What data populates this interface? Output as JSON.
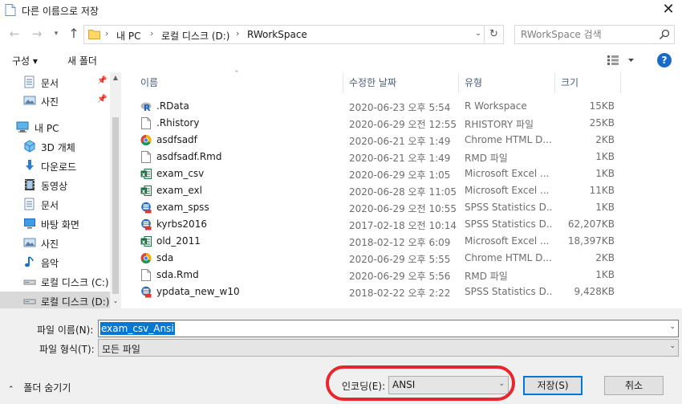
{
  "window": {
    "title": "다른 이름으로 저장",
    "close_glyph": "✕"
  },
  "address": {
    "crumbs": [
      "내 PC",
      "로컬 디스크 (D:)",
      "RWorkSpace"
    ],
    "search_placeholder": "RWorkSpace 검색"
  },
  "toolbar": {
    "organize": "구성 ▾",
    "new_folder": "새 폴더",
    "help": "?"
  },
  "nav": {
    "items": [
      {
        "label": "문서",
        "icon": "documents-icon",
        "pinned": true
      },
      {
        "label": "사진",
        "icon": "pictures-icon",
        "pinned": true
      },
      {
        "label": "내 PC",
        "icon": "this-pc-icon"
      },
      {
        "label": "3D 개체",
        "icon": "3d-objects-icon"
      },
      {
        "label": "다운로드",
        "icon": "downloads-icon"
      },
      {
        "label": "동영상",
        "icon": "videos-icon"
      },
      {
        "label": "문서",
        "icon": "documents-icon"
      },
      {
        "label": "바탕 화면",
        "icon": "desktop-icon"
      },
      {
        "label": "사진",
        "icon": "pictures-icon"
      },
      {
        "label": "음악",
        "icon": "music-icon"
      },
      {
        "label": "로컬 디스크 (C:)",
        "icon": "drive-icon"
      },
      {
        "label": "로컬 디스크 (D:)",
        "icon": "drive-icon",
        "selected": true
      }
    ]
  },
  "columns": {
    "name": "이름",
    "modified": "수정한 날짜",
    "type": "유형",
    "size": "크기"
  },
  "files": [
    {
      "name": ".RData",
      "date": "2020-06-23 오후 5:54",
      "type": "R Workspace",
      "size": "15KB",
      "icon": "r-icon"
    },
    {
      "name": ".Rhistory",
      "date": "2020-06-29 오전 12:55",
      "type": "RHISTORY 파일",
      "size": "25KB",
      "icon": "file-icon"
    },
    {
      "name": "asdfsadf",
      "date": "2020-06-21 오후 1:49",
      "type": "Chrome HTML D...",
      "size": "2KB",
      "icon": "chrome-icon"
    },
    {
      "name": "asdfsadf.Rmd",
      "date": "2020-06-21 오후 1:49",
      "type": "RMD 파일",
      "size": "1KB",
      "icon": "file-icon"
    },
    {
      "name": "exam_csv",
      "date": "2020-06-29 오후 1:05",
      "type": "Microsoft Excel ...",
      "size": "1KB",
      "icon": "excel-icon"
    },
    {
      "name": "exam_exl",
      "date": "2020-06-28 오후 11:05",
      "type": "Microsoft Excel ...",
      "size": "11KB",
      "icon": "excel-icon"
    },
    {
      "name": "exam_spss",
      "date": "2020-06-29 오전 10:55",
      "type": "SPSS Statistics D...",
      "size": "1KB",
      "icon": "spss-icon"
    },
    {
      "name": "kyrbs2016",
      "date": "2017-02-18 오전 10:14",
      "type": "SPSS Statistics D...",
      "size": "62,207KB",
      "icon": "spss-icon"
    },
    {
      "name": "old_2011",
      "date": "2018-02-12 오후 6:09",
      "type": "Microsoft Excel ...",
      "size": "18,397KB",
      "icon": "excel-icon"
    },
    {
      "name": "sda",
      "date": "2020-06-29 오후 5:55",
      "type": "Chrome HTML D...",
      "size": "2KB",
      "icon": "chrome-icon"
    },
    {
      "name": "sda.Rmd",
      "date": "2020-06-29 오후 5:56",
      "type": "RMD 파일",
      "size": "1KB",
      "icon": "file-icon"
    },
    {
      "name": "ypdata_new_w10",
      "date": "2018-02-22 오후 2:22",
      "type": "SPSS Statistics D...",
      "size": "9,428KB",
      "icon": "spss-icon"
    }
  ],
  "form": {
    "filename_label": "파일 이름(N):",
    "filename_value": "exam_csv_Ansi",
    "filetype_label": "파일 형식(T):",
    "filetype_value": "모든 파일",
    "hide_folders": "폴더 숨기기",
    "encoding_label": "인코딩(E):",
    "encoding_value": "ANSI",
    "save_label": "저장(S)",
    "cancel_label": "취소"
  },
  "colors": {
    "accent": "#0078d7",
    "highlight": "#e8262c"
  }
}
